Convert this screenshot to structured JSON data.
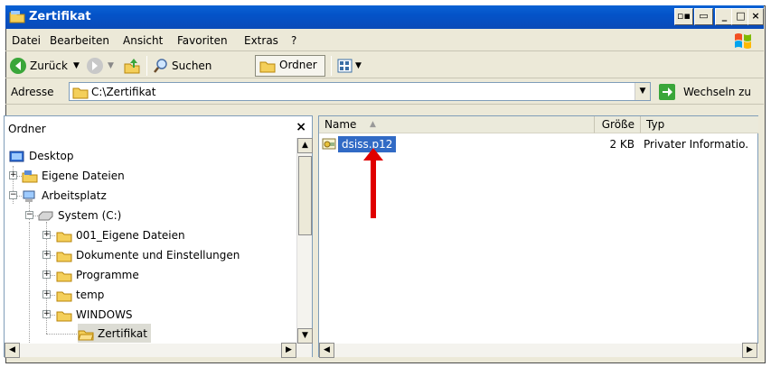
{
  "window": {
    "title": "Zertifikat"
  },
  "menu": {
    "items": [
      {
        "label": "Datei"
      },
      {
        "label": "Bearbeiten"
      },
      {
        "label": "Ansicht"
      },
      {
        "label": "Favoriten"
      },
      {
        "label": "Extras"
      },
      {
        "label": "?"
      }
    ]
  },
  "toolbar": {
    "back_label": "Zurück",
    "search_label": "Suchen",
    "folders_label": "Ordner"
  },
  "address": {
    "label": "Adresse",
    "value": "C:\\Zertifikat",
    "go_label": "Wechseln zu"
  },
  "folders_pane": {
    "title": "Ordner",
    "close_glyph": "×",
    "tree": [
      {
        "label": "Desktop"
      },
      {
        "label": "Eigene Dateien"
      },
      {
        "label": "Arbeitsplatz"
      },
      {
        "label": "System (C:)"
      },
      {
        "label": "001_Eigene Dateien"
      },
      {
        "label": "Dokumente und Einstellungen"
      },
      {
        "label": "Programme"
      },
      {
        "label": "temp"
      },
      {
        "label": "WINDOWS"
      },
      {
        "label": "Zertifikat"
      }
    ]
  },
  "file_list": {
    "columns": [
      {
        "label": "Name"
      },
      {
        "label": "Größe"
      },
      {
        "label": "Typ"
      }
    ],
    "rows": [
      {
        "name": "dsiss.p12",
        "size": "2 KB",
        "type": "Privater Informatio."
      }
    ]
  },
  "colors": {
    "titlebar": "#0a4bb8",
    "selection": "#316ac5",
    "annotation_arrow": "#e00000",
    "folder": "#f4cf5a"
  }
}
